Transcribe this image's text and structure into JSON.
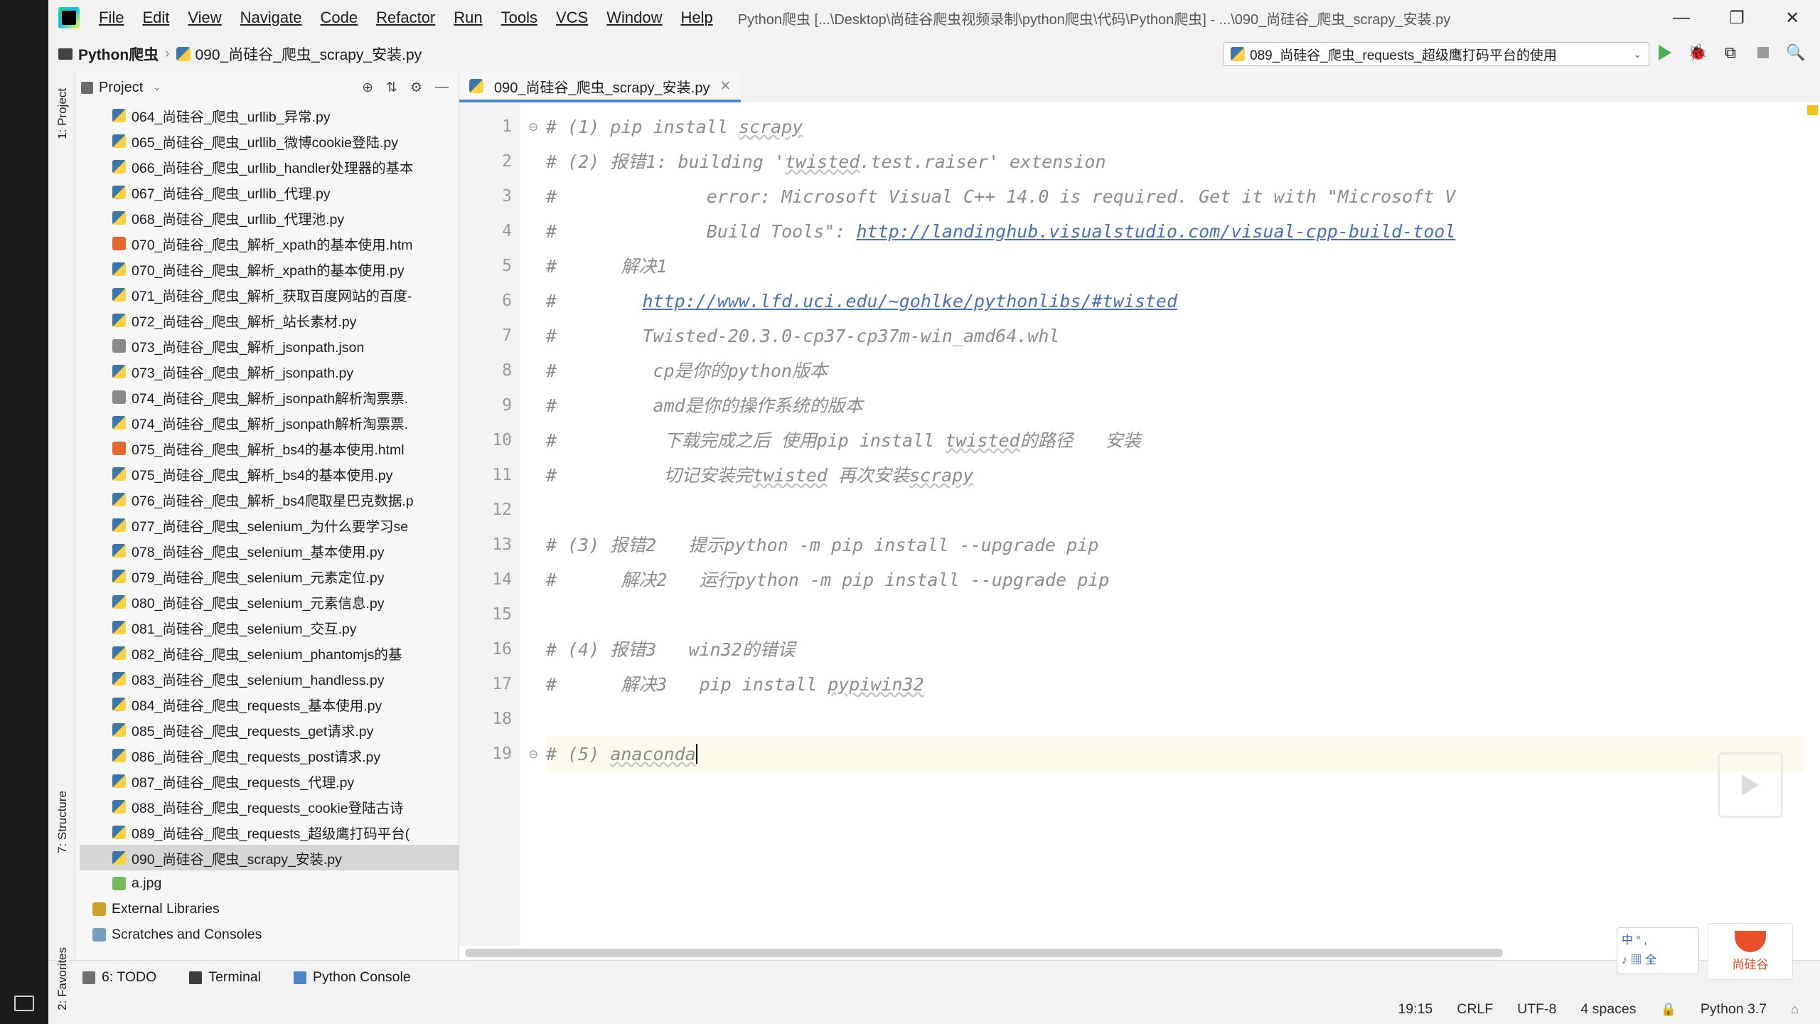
{
  "window": {
    "title": "Python爬虫 [...\\Desktop\\尚硅谷爬虫视频录制\\python爬虫\\代码\\Python爬虫] - ...\\090_尚硅谷_爬虫_scrapy_安装.py",
    "minimize": "—",
    "maximize": "❐",
    "close": "✕"
  },
  "menu": {
    "items": [
      {
        "label": "File"
      },
      {
        "label": "Edit"
      },
      {
        "label": "View"
      },
      {
        "label": "Navigate"
      },
      {
        "label": "Code"
      },
      {
        "label": "Refactor"
      },
      {
        "label": "Run"
      },
      {
        "label": "Tools"
      },
      {
        "label": "VCS"
      },
      {
        "label": "Window"
      },
      {
        "label": "Help"
      }
    ]
  },
  "breadcrumb": {
    "project": "Python爬虫",
    "separator": "›",
    "file": "090_尚硅谷_爬虫_scrapy_安装.py"
  },
  "run_config": {
    "label": "089_尚硅谷_爬虫_requests_超级鹰打码平台的使用",
    "caret": "⌄"
  },
  "toolbar": {
    "run_label": "▶",
    "debug_label": "🐞",
    "coverage_label": "⧉",
    "stop_label": "■",
    "search_label": "🔍"
  },
  "left_strip": {
    "tabs": [
      "1: Project",
      "7: Structure",
      "2: Favorites"
    ]
  },
  "project_pane": {
    "title": "Project",
    "caret": "⌄",
    "tools": [
      "⊕",
      "⇅",
      "⚙",
      "—"
    ],
    "items": [
      {
        "label": "064_尚硅谷_爬虫_urllib_异常.py",
        "type": "py"
      },
      {
        "label": "065_尚硅谷_爬虫_urllib_微博cookie登陆.py",
        "type": "py"
      },
      {
        "label": "066_尚硅谷_爬虫_urllib_handler处理器的基本",
        "type": "py"
      },
      {
        "label": "067_尚硅谷_爬虫_urllib_代理.py",
        "type": "py"
      },
      {
        "label": "068_尚硅谷_爬虫_urllib_代理池.py",
        "type": "py"
      },
      {
        "label": "070_尚硅谷_爬虫_解析_xpath的基本使用.htm",
        "type": "html"
      },
      {
        "label": "070_尚硅谷_爬虫_解析_xpath的基本使用.py",
        "type": "py"
      },
      {
        "label": "071_尚硅谷_爬虫_解析_获取百度网站的百度-",
        "type": "py"
      },
      {
        "label": "072_尚硅谷_爬虫_解析_站长素材.py",
        "type": "py"
      },
      {
        "label": "073_尚硅谷_爬虫_解析_jsonpath.json",
        "type": "json"
      },
      {
        "label": "073_尚硅谷_爬虫_解析_jsonpath.py",
        "type": "py"
      },
      {
        "label": "074_尚硅谷_爬虫_解析_jsonpath解析淘票票.",
        "type": "json"
      },
      {
        "label": "074_尚硅谷_爬虫_解析_jsonpath解析淘票票.",
        "type": "py"
      },
      {
        "label": "075_尚硅谷_爬虫_解析_bs4的基本使用.html",
        "type": "html"
      },
      {
        "label": "075_尚硅谷_爬虫_解析_bs4的基本使用.py",
        "type": "py"
      },
      {
        "label": "076_尚硅谷_爬虫_解析_bs4爬取星巴克数据.p",
        "type": "py"
      },
      {
        "label": "077_尚硅谷_爬虫_selenium_为什么要学习se",
        "type": "py"
      },
      {
        "label": "078_尚硅谷_爬虫_selenium_基本使用.py",
        "type": "py"
      },
      {
        "label": "079_尚硅谷_爬虫_selenium_元素定位.py",
        "type": "py"
      },
      {
        "label": "080_尚硅谷_爬虫_selenium_元素信息.py",
        "type": "py"
      },
      {
        "label": "081_尚硅谷_爬虫_selenium_交互.py",
        "type": "py"
      },
      {
        "label": "082_尚硅谷_爬虫_selenium_phantomjs的基",
        "type": "py"
      },
      {
        "label": "083_尚硅谷_爬虫_selenium_handless.py",
        "type": "py"
      },
      {
        "label": "084_尚硅谷_爬虫_requests_基本使用.py",
        "type": "py"
      },
      {
        "label": "085_尚硅谷_爬虫_requests_get请求.py",
        "type": "py"
      },
      {
        "label": "086_尚硅谷_爬虫_requests_post请求.py",
        "type": "py"
      },
      {
        "label": "087_尚硅谷_爬虫_requests_代理.py",
        "type": "py"
      },
      {
        "label": "088_尚硅谷_爬虫_requests_cookie登陆古诗",
        "type": "py"
      },
      {
        "label": "089_尚硅谷_爬虫_requests_超级鹰打码平台(",
        "type": "py"
      },
      {
        "label": "090_尚硅谷_爬虫_scrapy_安装.py",
        "type": "py",
        "selected": true
      },
      {
        "label": "a.jpg",
        "type": "jpg"
      },
      {
        "label": "External Libraries",
        "type": "lib",
        "root": true
      },
      {
        "label": "Scratches and Consoles",
        "type": "scr",
        "root": true
      }
    ]
  },
  "editor": {
    "tab": {
      "label": "090_尚硅谷_爬虫_scrapy_安装.py",
      "close": "✕"
    },
    "lines": [
      {
        "n": "1",
        "fold": "⊖",
        "text": "# (1) pip install scrapy"
      },
      {
        "n": "2",
        "fold": "",
        "text": "# (2) 报错1: building 'twisted.test.raiser' extension"
      },
      {
        "n": "3",
        "fold": "",
        "text": "#              error: Microsoft Visual C++ 14.0 is required. Get it with \"Microsoft V"
      },
      {
        "n": "4",
        "fold": "",
        "text": "#              Build Tools\": http://landinghub.visualstudio.com/visual-cpp-build-tool"
      },
      {
        "n": "5",
        "fold": "",
        "text": "#      解决1"
      },
      {
        "n": "6",
        "fold": "",
        "text": "#        http://www.lfd.uci.edu/~gohlke/pythonlibs/#twisted"
      },
      {
        "n": "7",
        "fold": "",
        "text": "#        Twisted-20.3.0-cp37-cp37m-win_amd64.whl"
      },
      {
        "n": "8",
        "fold": "",
        "text": "#         cp是你的python版本"
      },
      {
        "n": "9",
        "fold": "",
        "text": "#         amd是你的操作系统的版本"
      },
      {
        "n": "10",
        "fold": "",
        "text": "#          下载完成之后 使用pip install twisted的路径   安装"
      },
      {
        "n": "11",
        "fold": "",
        "text": "#          切记安装完twisted 再次安装scrapy"
      },
      {
        "n": "12",
        "fold": "",
        "text": ""
      },
      {
        "n": "13",
        "fold": "",
        "text": "# (3) 报错2   提示python -m pip install --upgrade pip"
      },
      {
        "n": "14",
        "fold": "",
        "text": "#      解决2   运行python -m pip install --upgrade pip"
      },
      {
        "n": "15",
        "fold": "",
        "text": ""
      },
      {
        "n": "16",
        "fold": "",
        "text": "# (4) 报错3   win32的错误"
      },
      {
        "n": "17",
        "fold": "",
        "text": "#      解决3   pip install pypiwin32"
      },
      {
        "n": "18",
        "fold": "",
        "text": ""
      },
      {
        "n": "19",
        "fold": "⊖",
        "text": "# (5) anaconda",
        "current": true
      }
    ]
  },
  "bottom_tools": [
    {
      "label": "6: TODO",
      "icon": "list-icon"
    },
    {
      "label": "Terminal",
      "icon": "terminal-icon"
    },
    {
      "label": "Python Console",
      "icon": "python-console-icon"
    }
  ],
  "status": {
    "caret_pos": "19:15",
    "line_sep": "CRLF",
    "encoding": "UTF-8",
    "indent": "4 spaces",
    "interpreter": "Python 3.7",
    "lock": "🔒",
    "event": "⌂"
  },
  "ime": {
    "line1": "中 ° ,",
    "line2": "♪ ▦ 全"
  },
  "brand": {
    "text": "尚硅谷"
  },
  "colors": {
    "accent": "#4a86c7",
    "selection": "#d6d6d6",
    "comment": "#8c8c8c",
    "link": "#4a6fb5",
    "current_line": "#fcfaed"
  }
}
